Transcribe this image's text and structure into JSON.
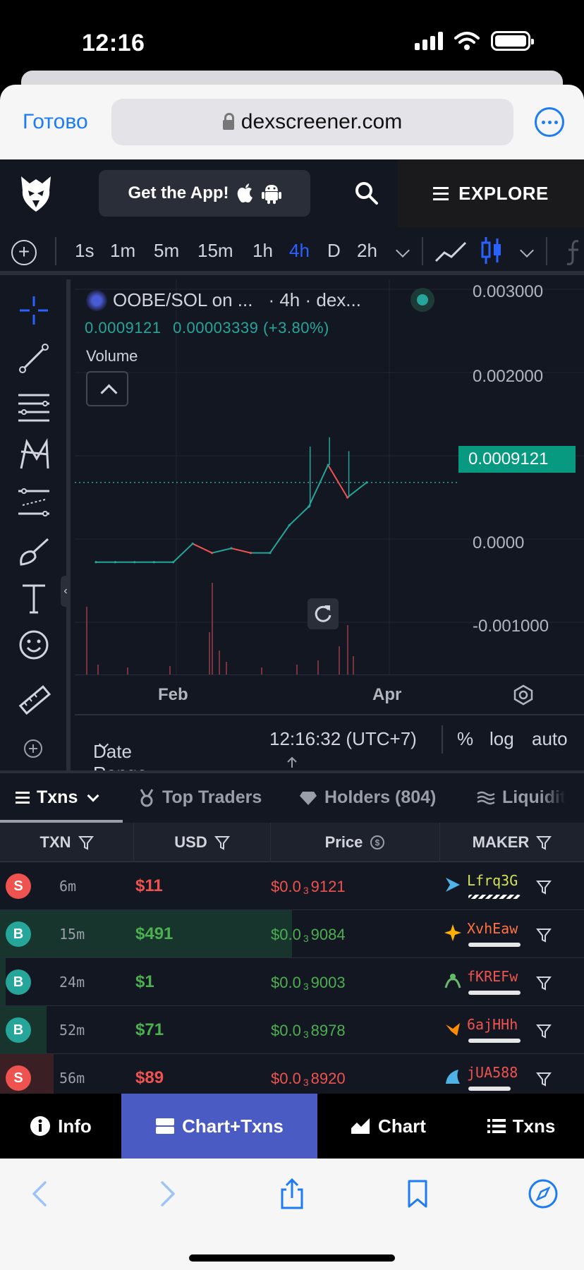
{
  "status_bar": {
    "time": "12:16"
  },
  "browser": {
    "done_label": "Готово",
    "url": "dexscreener.com"
  },
  "header": {
    "get_app_label": "Get the App!",
    "explore_label": "EXPLORE"
  },
  "chart_toolbar": {
    "timeframes": [
      "1s",
      "1m",
      "5m",
      "15m",
      "1h",
      "4h",
      "D",
      "2h"
    ],
    "active_timeframe": "4h"
  },
  "chart": {
    "pair_title": "OOBE/SOL on ...",
    "interval_source": "· 4h · dex...",
    "last_price": "0.0009121",
    "change": "0.00003339 (+3.80%)",
    "volume_label": "Volume",
    "price_tag": "0.0009121",
    "y_ticks": [
      "0.003000",
      "0.002000",
      "0.0000",
      "-0.001000"
    ],
    "x_ticks": [
      "Feb",
      "Apr"
    ],
    "date_range_label": "Date Range",
    "clock": "12:16:32 (UTC+7)",
    "percent_label": "%",
    "log_label": "log",
    "auto_label": "auto",
    "accent_up": "#26a69a",
    "accent_down": "#ef5350"
  },
  "chart_data": {
    "type": "line",
    "title": "OOBE/SOL on ...",
    "xlabel": "",
    "ylabel": "",
    "x_ticks": [
      "Feb",
      "Apr"
    ],
    "ylim": [
      -0.0015,
      0.003
    ],
    "series": [
      {
        "name": "OOBE/SOL",
        "x": [
          "Jan 15",
          "Jan 29",
          "Feb 12",
          "Feb 26",
          "Mar 6",
          "Mar 8",
          "Mar 15",
          "Mar 22",
          "Mar 29",
          "Apr 3",
          "Apr 5",
          "Apr 7",
          "Apr 8",
          "Apr 9",
          "Apr 10"
        ],
        "values": [
          5e-05,
          5e-05,
          5e-05,
          5e-05,
          5e-05,
          0.00025,
          0.00015,
          0.0002,
          0.00015,
          0.00015,
          0.00045,
          0.00065,
          0.0011,
          0.00075,
          0.0009121
        ]
      }
    ]
  },
  "tabs": {
    "txns_label": "Txns",
    "top_traders_label": "Top Traders",
    "holders_label": "Holders (804)",
    "liquidity_label": "Liquidit"
  },
  "table": {
    "headers": {
      "txn": "TXN",
      "usd": "USD",
      "price": "Price",
      "maker": "MAKER"
    },
    "rows": [
      {
        "type": "S",
        "age": "6m",
        "usd": "$11",
        "price_prefix": "$0.0",
        "price_sub": "3",
        "price_rest": "9121",
        "maker": "Lfrq3G"
      },
      {
        "type": "B",
        "age": "15m",
        "usd": "$491",
        "price_prefix": "$0.0",
        "price_sub": "3",
        "price_rest": "9084",
        "maker": "XvhEaw"
      },
      {
        "type": "B",
        "age": "24m",
        "usd": "$1",
        "price_prefix": "$0.0",
        "price_sub": "3",
        "price_rest": "9003",
        "maker": "fKREFw"
      },
      {
        "type": "B",
        "age": "52m",
        "usd": "$71",
        "price_prefix": "$0.0",
        "price_sub": "3",
        "price_rest": "8978",
        "maker": "6ajHHh"
      },
      {
        "type": "S",
        "age": "56m",
        "usd": "$89",
        "price_prefix": "$0.0",
        "price_sub": "3",
        "price_rest": "8920",
        "maker": "jUA588"
      }
    ]
  },
  "bottom_nav": {
    "info_label": "Info",
    "chart_txns_label": "Chart+Txns",
    "chart_label": "Chart",
    "txns_label": "Txns"
  }
}
